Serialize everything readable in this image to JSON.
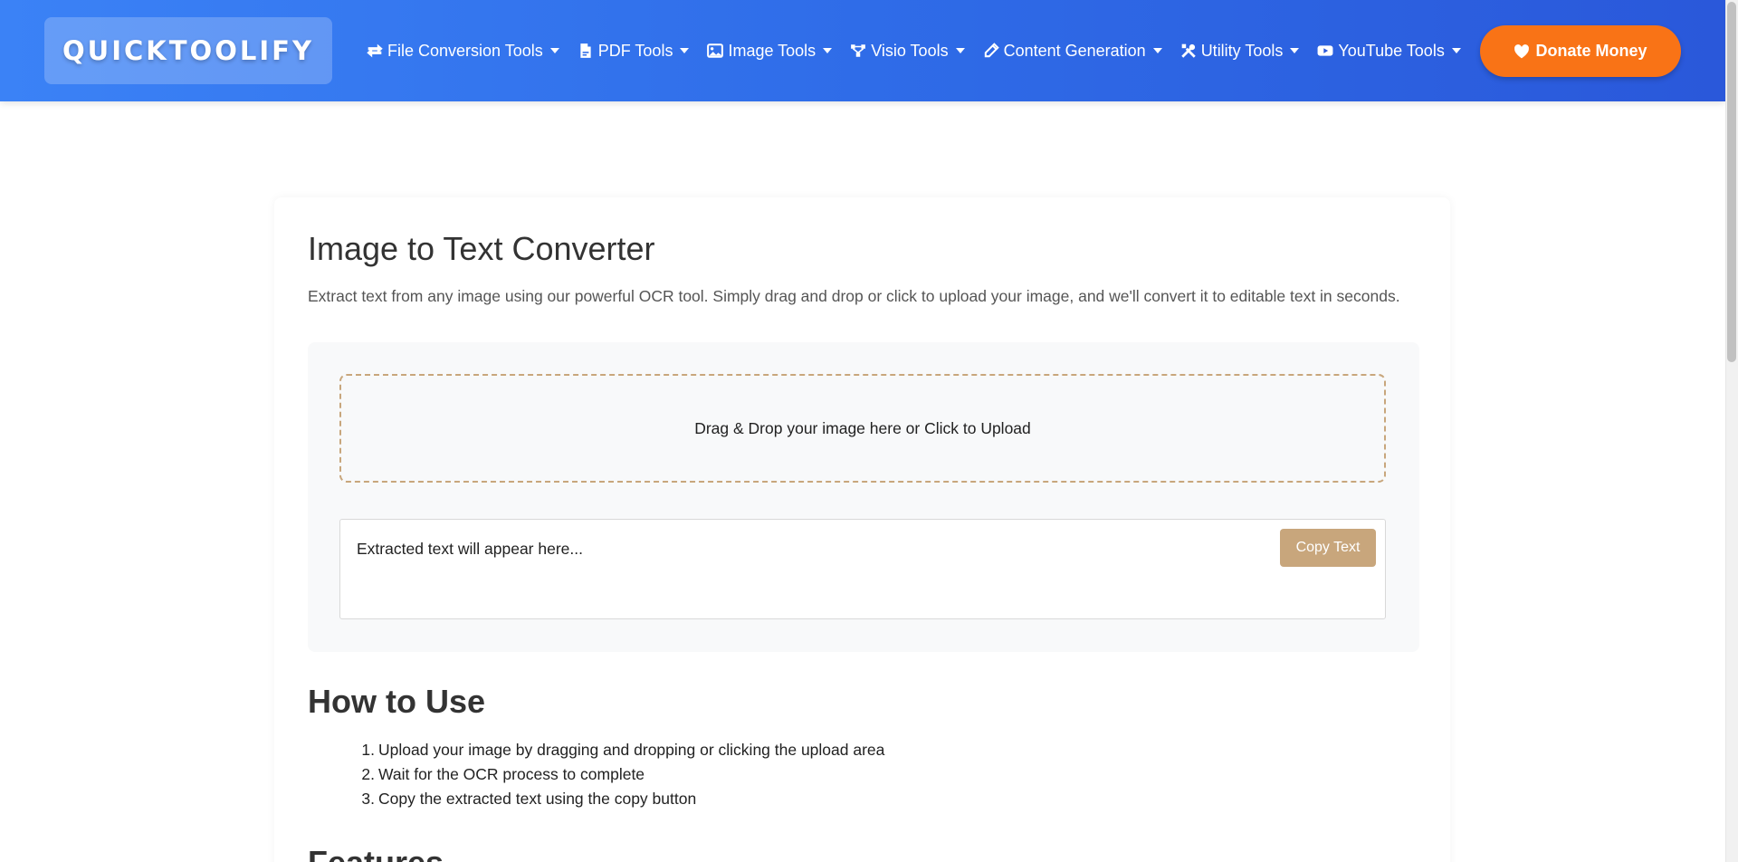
{
  "navbar": {
    "brand": "QUICKTOOLIFY",
    "items": [
      {
        "label": "File Conversion Tools",
        "icon": "exchange-icon"
      },
      {
        "label": "PDF Tools",
        "icon": "pdf-file-icon"
      },
      {
        "label": "Image Tools",
        "icon": "image-icon"
      },
      {
        "label": "Visio Tools",
        "icon": "diagram-icon"
      },
      {
        "label": "Content Generation",
        "icon": "pencil-icon"
      },
      {
        "label": "Utility Tools",
        "icon": "tools-icon"
      },
      {
        "label": "YouTube Tools",
        "icon": "youtube-icon"
      }
    ],
    "donate_label": "Donate Money"
  },
  "main": {
    "title": "Image to Text Converter",
    "description": "Extract text from any image using our powerful OCR tool. Simply drag and drop or click to upload your image, and we'll convert it to editable text in seconds.",
    "drop_zone_label": "Drag & Drop your image here or Click to Upload",
    "output_placeholder": "Extracted text will appear here...",
    "copy_label": "Copy Text",
    "how_to_title": "How to Use",
    "steps": [
      {
        "num": "1.",
        "text": "Upload your image by dragging and dropping or clicking the upload area"
      },
      {
        "num": "2.",
        "text": "Wait for the OCR process to complete"
      },
      {
        "num": "3.",
        "text": "Copy the extracted text using the copy button"
      }
    ],
    "features_title": "Features"
  },
  "colors": {
    "nav_gradient_start": "#3b82f6",
    "nav_gradient_end": "#2a58da",
    "donate": "#f97316",
    "accent_tan": "#c8a67c"
  }
}
